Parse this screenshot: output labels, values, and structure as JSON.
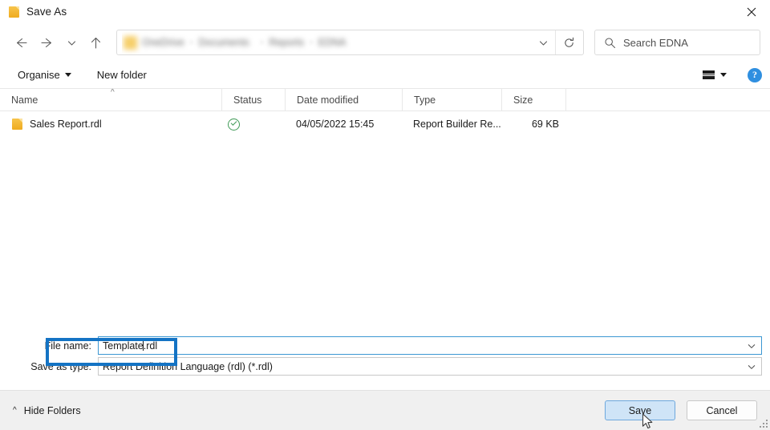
{
  "window": {
    "title": "Save As",
    "icon": "report-file-icon",
    "close_label": "✕"
  },
  "nav": {
    "back": "back-arrow-icon",
    "forward": "forward-arrow-icon",
    "recent": "chevron-down-icon",
    "up": "up-arrow-icon",
    "refresh": "refresh-icon",
    "breadcrumb": {
      "redacted": true,
      "segments": [
        "",
        "",
        "",
        ""
      ],
      "separator": "›"
    },
    "search": {
      "placeholder": "Search EDNA",
      "icon": "search-icon",
      "value": ""
    }
  },
  "commandbar": {
    "organise_label": "Organise",
    "new_folder_label": "New folder",
    "view_icon": "list-view-icon",
    "view_caret": "chevron-down-icon",
    "help_label": "?"
  },
  "filelist": {
    "columns": [
      {
        "label": "Name",
        "sorted": true,
        "sort_dir": "asc"
      },
      {
        "label": "Status",
        "sorted": false
      },
      {
        "label": "Date modified",
        "sorted": false
      },
      {
        "label": "Type",
        "sorted": false
      },
      {
        "label": "Size",
        "sorted": false
      }
    ],
    "rows": [
      {
        "name": "Sales Report.rdl",
        "status_icon": "cloud-synced-check-icon",
        "status_color": "#3f9a56",
        "date_modified": "04/05/2022 15:45",
        "type": "Report Builder Re...",
        "size": "69 KB",
        "icon": "report-file-icon"
      }
    ]
  },
  "form": {
    "file_name": {
      "label": "File name:",
      "value_before_caret": "Template",
      "value_after_caret": ".rdl",
      "full_value": "Template.rdl",
      "focused": true,
      "chevron": "chevron-down-icon"
    },
    "save_as_type": {
      "label": "Save as type:",
      "value": "Report Definition Language (rdl)  (*.rdl)",
      "chevron": "chevron-down-icon"
    },
    "highlight_color": "#1473c4"
  },
  "footer": {
    "hide_folders_label": "Hide Folders",
    "hide_folders_chevron": "chevron-up-icon",
    "save_label": "Save",
    "cancel_label": "Cancel",
    "save_hovered": true
  }
}
